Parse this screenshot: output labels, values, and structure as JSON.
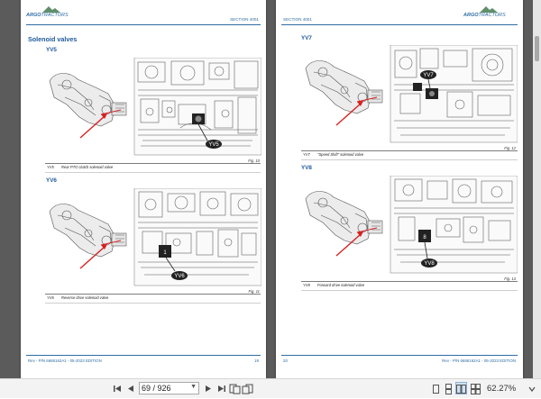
{
  "document": {
    "brand": "ARGO",
    "brand_suffix": "TRACTORS",
    "section": "SECTION 4001",
    "footer_edition": "Rev - P/N 6686162A1 - 05-2023 EDITION",
    "left_page": {
      "number": "19",
      "title": "Solenoid valves",
      "figures": [
        {
          "heading": "YV5",
          "callout": "YV5",
          "fig_label": "Fig. 10",
          "caption_code": "YV5",
          "caption_text": "Rear PTO clutch solenoid valve"
        },
        {
          "heading": "YV6",
          "callout": "YV6",
          "fig_label": "Fig. 11",
          "caption_code": "YV6",
          "caption_text": "Reverse drive solenoid valve"
        }
      ]
    },
    "right_page": {
      "number": "20",
      "figures": [
        {
          "heading": "YV7",
          "callout": "YV7",
          "fig_label": "Fig. 12",
          "caption_code": "YV7",
          "caption_text": "\"Speed Shift\" solenoid valve"
        },
        {
          "heading": "YV8",
          "callout": "YV8",
          "fig_label": "Fig. 13",
          "caption_code": "YV8",
          "caption_text": "Forward drive solenoid valve"
        }
      ]
    }
  },
  "toolbar": {
    "first_page_icon": "first-page-icon",
    "prev_page_icon": "prev-page-icon",
    "page_field": "69 / 926",
    "next_page_icon": "next-page-icon",
    "last_page_icon": "last-page-icon",
    "zoom": "62.27%"
  },
  "colors": {
    "accent_blue": "#1f5aa0",
    "arrow_red": "#d62020",
    "viewer_background": "#5b5b5b"
  }
}
